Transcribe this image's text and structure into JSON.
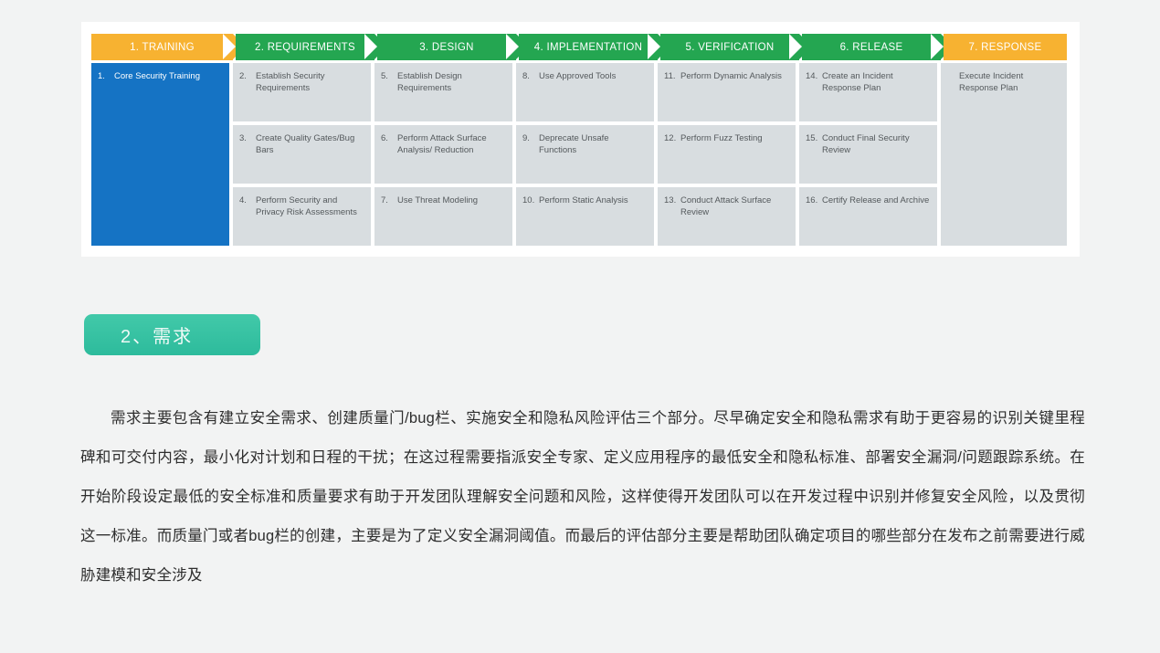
{
  "diagram": {
    "name": "microsoft-sdl-practices",
    "colors": {
      "orange": "#f7b231",
      "green": "#24a651",
      "blue": "#1573c4",
      "cell_grey": "#d8dde0",
      "card_white": "#ffffff",
      "page_grey": "#f2f3f3"
    },
    "phases": [
      {
        "label": "1. TRAINING",
        "style": "orange"
      },
      {
        "label": "2. REQUIREMENTS",
        "style": "green"
      },
      {
        "label": "3. DESIGN",
        "style": "green"
      },
      {
        "label": "4. IMPLEMENTATION",
        "style": "green"
      },
      {
        "label": "5. VERIFICATION",
        "style": "green"
      },
      {
        "label": "6. RELEASE",
        "style": "green"
      },
      {
        "label": "7. RESPONSE",
        "style": "orange"
      }
    ],
    "columns": [
      {
        "phase": "1. TRAINING",
        "cells": [
          {
            "num": "1.",
            "text": "Core Security Training",
            "style": "blue",
            "span": 3
          }
        ]
      },
      {
        "phase": "2. REQUIREMENTS",
        "cells": [
          {
            "num": "2.",
            "text": "Establish Security Requirements"
          },
          {
            "num": "3.",
            "text": "Create Quality Gates/Bug Bars"
          },
          {
            "num": "4.",
            "text": "Perform Security and Privacy Risk Assessments"
          }
        ]
      },
      {
        "phase": "3. DESIGN",
        "cells": [
          {
            "num": "5.",
            "text": "Establish Design Requirements"
          },
          {
            "num": "6.",
            "text": "Perform Attack Surface Analysis/ Reduction"
          },
          {
            "num": "7.",
            "text": "Use Threat Modeling"
          }
        ]
      },
      {
        "phase": "4. IMPLEMENTATION",
        "cells": [
          {
            "num": "8.",
            "text": "Use Approved Tools"
          },
          {
            "num": "9.",
            "text": "Deprecate Unsafe Functions"
          },
          {
            "num": "10.",
            "text": "Perform Static Analysis"
          }
        ]
      },
      {
        "phase": "5. VERIFICATION",
        "cells": [
          {
            "num": "11.",
            "text": "Perform Dynamic Analysis"
          },
          {
            "num": "12.",
            "text": "Perform Fuzz Testing"
          },
          {
            "num": "13.",
            "text": "Conduct Attack Surface Review"
          }
        ]
      },
      {
        "phase": "6. RELEASE",
        "cells": [
          {
            "num": "14.",
            "text": "Create an Incident Response Plan"
          },
          {
            "num": "15.",
            "text": "Conduct Final Security Review"
          },
          {
            "num": "16.",
            "text": "Certify Release and Archive"
          }
        ]
      },
      {
        "phase": "7. RESPONSE",
        "cells": [
          {
            "num": "",
            "text": "Execute Incident Response Plan",
            "style": "plain",
            "span": 3
          }
        ]
      }
    ]
  },
  "section": {
    "badge_label": "2、需求",
    "badge_color": "#35c4a4"
  },
  "article": {
    "paragraph": "需求主要包含有建立安全需求、创建质量门/bug栏、实施安全和隐私风险评估三个部分。尽早确定安全和隐私需求有助于更容易的识别关键里程碑和可交付内容，最小化对计划和日程的干扰；在这过程需要指派安全专家、定义应用程序的最低安全和隐私标准、部署安全漏洞/问题跟踪系统。在开始阶段设定最低的安全标准和质量要求有助于开发团队理解安全问题和风险，这样使得开发团队可以在开发过程中识别并修复安全风险，以及贯彻这一标准。而质量门或者bug栏的创建，主要是为了定义安全漏洞阈值。而最后的评估部分主要是帮助团队确定项目的哪些部分在发布之前需要进行威胁建模和安全涉及"
  }
}
